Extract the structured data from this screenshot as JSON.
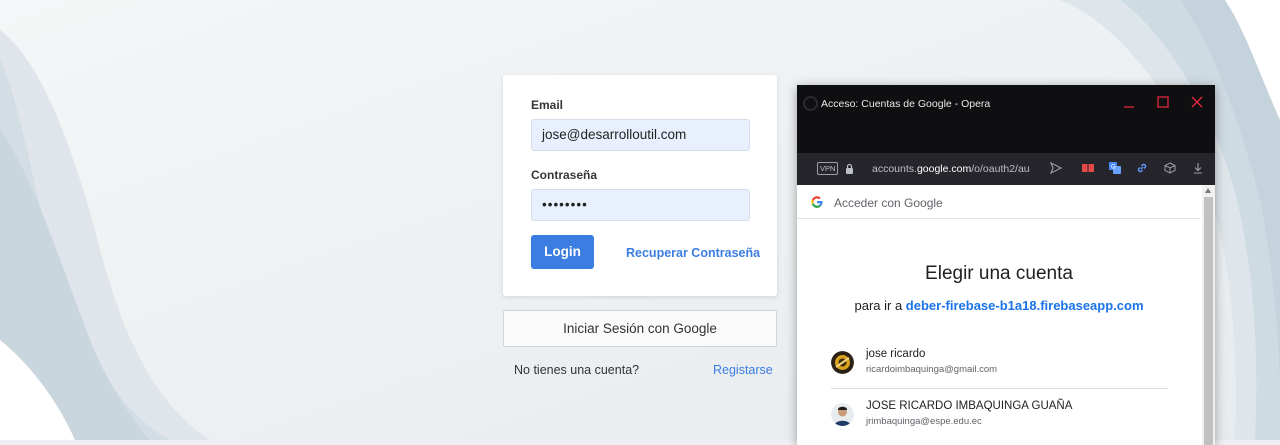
{
  "login_form": {
    "email_label": "Email",
    "email_value": "jose@desarrolloutil.com",
    "password_label": "Contraseña",
    "password_value": "••••••••",
    "login_button": "Login",
    "recover_link": "Recuperar Contraseña"
  },
  "google_signin_button": "Iniciar Sesión con Google",
  "register": {
    "prompt": "No tienes una cuenta?",
    "link": "Registarse"
  },
  "popup": {
    "window_title": "Acceso: Cuentas de Google - Opera",
    "vpn_badge": "VPN",
    "url_prefix": "accounts.",
    "url_domain": "google.com",
    "url_path": "/o/oauth2/au",
    "header": "Acceder con Google",
    "heading": "Elegir una cuenta",
    "continue_prefix": "para ir a ",
    "continue_domain": "deber-firebase-b1a18.firebaseapp.com",
    "accounts": [
      {
        "name": "jose ricardo",
        "email": "ricardoimbaquinga@gmail.com"
      },
      {
        "name": "JOSE RICARDO IMBAQUINGA GUAÑA",
        "email": "jrimbaquinga@espe.edu.ec"
      }
    ]
  },
  "colors": {
    "accent": "#3b7de0",
    "google_link": "#1a73e8",
    "titlebar": "#0f0f12",
    "close_red": "#e0283c"
  }
}
